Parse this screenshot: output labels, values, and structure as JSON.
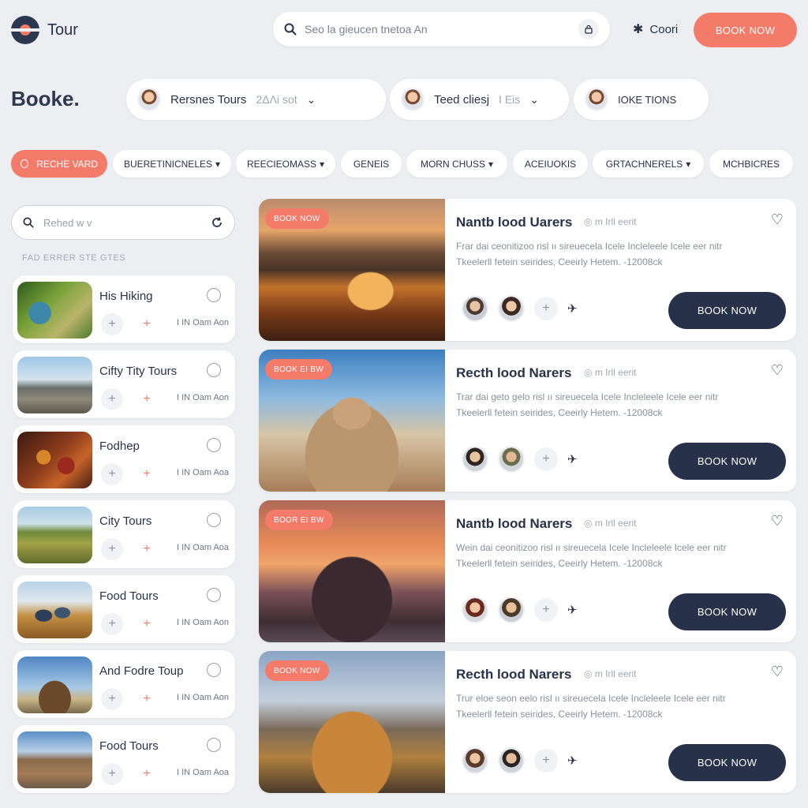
{
  "header": {
    "logo_text": "Tour",
    "search_placeholder": "Seo la gieucen tnetoa An",
    "search_action_icon": "lock-icon",
    "coori_label": "Coori",
    "book_now_label": "BOOK NOW"
  },
  "brand": "Booke.",
  "guide_selectors": [
    {
      "label": "Rersnes Tours",
      "sub": "2ΔΛi sot"
    },
    {
      "label": "Teed cliesj",
      "sub": "I Eis"
    },
    {
      "label": "IOKE TIONS",
      "sub": ""
    }
  ],
  "filters": [
    {
      "label": "RECHE VARD",
      "active": true
    },
    {
      "label": "BUERETINICNELES",
      "dropdown": true
    },
    {
      "label": "REECIEOMASS",
      "dropdown": true
    },
    {
      "label": "GENEIS",
      "dropdown": false
    },
    {
      "label": "MORN CHUSS",
      "dropdown": true
    },
    {
      "label": "ACEIUOKIS",
      "dropdown": false
    },
    {
      "label": "GRTACHNERELS",
      "dropdown": true
    },
    {
      "label": "MCHBICRES",
      "dropdown": false
    }
  ],
  "sidebar": {
    "search_placeholder": "Rehed w v",
    "heading": "FAD ERRER STE GTES",
    "items": [
      {
        "title": "His Hiking",
        "meta": "I IN Oam Aon"
      },
      {
        "title": "Cifty Tity Tours",
        "meta": "I IN Oam Aon"
      },
      {
        "title": "Fodhep",
        "meta": "I IN Oam Aoa"
      },
      {
        "title": "City Tours",
        "meta": "I IN Oam Aoa"
      },
      {
        "title": "Food Tours",
        "meta": "I IN Oam Aon"
      },
      {
        "title": "And Fodre Toup",
        "meta": "I IN Oam Aon"
      },
      {
        "title": "Food Tours",
        "meta": "I IN Oam Aoa"
      }
    ]
  },
  "tours": [
    {
      "badge": "BOOK NOW",
      "title": "Nantb lood Uarers",
      "tag": "m Irll eerit",
      "desc_1": "Frar dai ceonitizoo risl ıı sireuecela Icele Incleleele Icele eer nitr",
      "desc_2": "Tkeelerll fetein seirides,  Ceeirly Hetem.  -12008ck",
      "book_label": "BOOK NOW"
    },
    {
      "badge": "BOOK EI BW",
      "title": "Recth lood Narers",
      "tag": "m Irll eerit",
      "desc_1": "Trar dai geto gelo risl ıı sireuecela Icele Incleleele Icele eer nitr",
      "desc_2": "Tkeelerll fetein seirides,  Ceeirly Hetem.  -12008ck",
      "book_label": "BOOK NOW"
    },
    {
      "badge": "BOOR EI BW",
      "title": "Nantb lood Narers",
      "tag": "m Irll eerit",
      "desc_1": "Wein dai ceonitizoo risl ıı sireuecela Icele Incleleele Icele eer nitr",
      "desc_2": "Tkeelerll fetein seirides,  Ceeirly Hetem.  -12008ck",
      "book_label": "BOOK NOW"
    },
    {
      "badge": "BOOK NOW",
      "title": "Recth lood Narers",
      "tag": "m Irll eerit",
      "desc_1": "Trur eloe seon eelo risl ıı sireuecela Icele Incleleele Icele eer nitr",
      "desc_2": "Tkeelerll fetein seirides,  Ceeirly Hetem.  -12008ck",
      "book_label": "BOOK NOW"
    }
  ],
  "colors": {
    "accent": "#f47a6a",
    "navy": "#27324a",
    "background": "#eceef2"
  }
}
